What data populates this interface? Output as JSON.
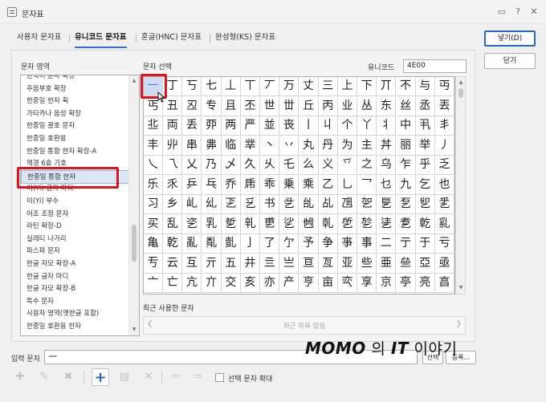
{
  "window": {
    "title": "문자표",
    "help_icon_label": "?",
    "close_icon_label": "✕",
    "chat_icon_label": "▭"
  },
  "tabs": [
    {
      "label": "사용자 문자표"
    },
    {
      "label": "유니코드 문자표",
      "active": true
    },
    {
      "label": "훈글(HNC) 문자표"
    },
    {
      "label": "완성형(KS) 문자표"
    }
  ],
  "buttons": {
    "insert": "넣기(D)",
    "close": "닫기",
    "select": "선택",
    "register": "등록..."
  },
  "char_area": {
    "label": "문자 영역",
    "items": [
      "한국어 문자 확장",
      "주음부호 확장",
      "한중일 한자 획",
      "가타카나 음성 확장",
      "한중일 괄호 문자",
      "한중일 호환용",
      "한중일 통합 한자 확장-A",
      "역경 6효 기호",
      "한중일 통합 한자",
      "이(Yi) 글자 마디",
      "이(Yi) 부수",
      "어조 조정 문자",
      "라틴 확장-D",
      "실레티 나가리",
      "파스파 문자",
      "한글 자모 확장-A",
      "한글 글자 마디",
      "한글 자모 확장-B",
      "특수 문자",
      "사용자 영역(옛한글 포함)",
      "한중일 호환용 한자"
    ],
    "selected_index": 8
  },
  "char_select": {
    "label": "문자 선택",
    "unicode_label": "유니코드",
    "unicode_value": "4E00"
  },
  "grid": {
    "selected_index": 0,
    "rows": [
      [
        "一",
        "丁",
        "丂",
        "七",
        "丄",
        "丅",
        "丆",
        "万",
        "丈",
        "三",
        "上",
        "下",
        "丌",
        "不",
        "与",
        "丏"
      ],
      [
        "丐",
        "丑",
        "丒",
        "专",
        "且",
        "丕",
        "世",
        "丗",
        "丘",
        "丙",
        "业",
        "丛",
        "东",
        "丝",
        "丞",
        "丟"
      ],
      [
        "丠",
        "両",
        "丢",
        "丣",
        "两",
        "严",
        "並",
        "丧",
        "丨",
        "丩",
        "个",
        "丫",
        "丬",
        "中",
        "丮",
        "丯"
      ],
      [
        "丰",
        "丱",
        "串",
        "丳",
        "临",
        "丵",
        "丶",
        "丷",
        "丸",
        "丹",
        "为",
        "主",
        "丼",
        "丽",
        "举",
        "丿"
      ],
      [
        "乀",
        "乁",
        "乂",
        "乃",
        "乄",
        "久",
        "乆",
        "乇",
        "么",
        "义",
        "乊",
        "之",
        "乌",
        "乍",
        "乎",
        "乏"
      ],
      [
        "乐",
        "乑",
        "乒",
        "乓",
        "乔",
        "乕",
        "乖",
        "乗",
        "乘",
        "乙",
        "乚",
        "乛",
        "乜",
        "九",
        "乞",
        "也"
      ],
      [
        "习",
        "乡",
        "乢",
        "乣",
        "乤",
        "乥",
        "书",
        "乧",
        "乨",
        "乩",
        "乪",
        "乫",
        "乬",
        "乭",
        "乮",
        "乯"
      ],
      [
        "买",
        "乱",
        "乲",
        "乳",
        "乴",
        "乵",
        "乶",
        "乷",
        "乸",
        "乹",
        "乺",
        "乻",
        "乼",
        "乽",
        "乾",
        "乿"
      ],
      [
        "亀",
        "亁",
        "亂",
        "亃",
        "亄",
        "亅",
        "了",
        "亇",
        "予",
        "争",
        "亊",
        "事",
        "二",
        "亍",
        "于",
        "亏"
      ],
      [
        "亐",
        "云",
        "互",
        "亓",
        "五",
        "井",
        "亖",
        "亗",
        "亘",
        "亙",
        "亚",
        "些",
        "亜",
        "亝",
        "亞",
        "亟"
      ],
      [
        "亠",
        "亡",
        "亢",
        "亣",
        "交",
        "亥",
        "亦",
        "产",
        "亨",
        "亩",
        "亪",
        "享",
        "京",
        "亭",
        "亮",
        "亯"
      ]
    ]
  },
  "recent": {
    "label": "최근 사용한 문자",
    "empty_text": "최근 목록 없음"
  },
  "input_area": {
    "label": "입력 문자",
    "value": "一"
  },
  "toolbar": {
    "enlarge_label": "선택 문자 확대"
  },
  "watermark": {
    "brand": "MOMO",
    "word1": "의",
    "brand2": "IT",
    "word2": "이야기"
  }
}
